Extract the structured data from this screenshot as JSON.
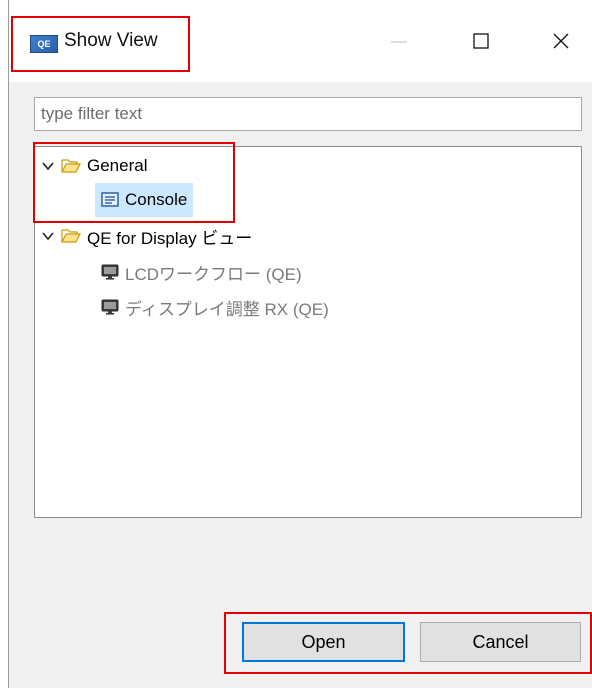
{
  "window": {
    "title": "Show View",
    "app_icon_text": "QE",
    "controls": [
      "minimize-icon",
      "maximize-icon",
      "close-icon"
    ]
  },
  "filter": {
    "placeholder": "type filter text",
    "value": ""
  },
  "tree": {
    "groups": [
      {
        "label": "General",
        "expanded": true,
        "items": [
          {
            "label": "Console",
            "selected": true,
            "enabled": true
          }
        ]
      },
      {
        "label": "QE for Display ビュー",
        "expanded": true,
        "items": [
          {
            "label": "LCDワークフロー (QE)",
            "selected": false,
            "enabled": false
          },
          {
            "label": "ディスプレイ調整 RX (QE)",
            "selected": false,
            "enabled": false
          }
        ]
      }
    ]
  },
  "buttons": {
    "open": "Open",
    "cancel": "Cancel"
  },
  "colors": {
    "selection": "#cce8ff",
    "default_button_border": "#0078d7",
    "annotation": "#e00000"
  }
}
